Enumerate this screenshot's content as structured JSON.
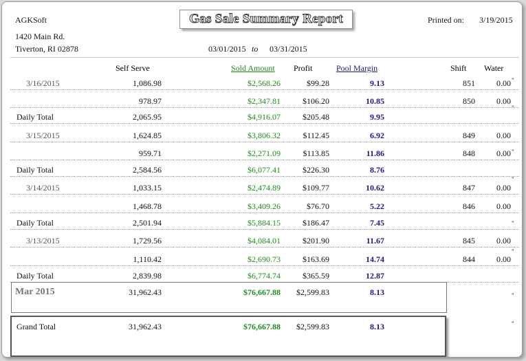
{
  "header": {
    "company": "AGKSoft",
    "address1": "1420 Main Rd.",
    "address2": "Tiverton, RI 02878",
    "title": "Gas Sale Summary Report",
    "printed_label": "Printed on:",
    "printed_date": "3/19/2015",
    "date_from": "03/01/2015",
    "date_to_word": "to",
    "date_to": "03/31/2015"
  },
  "columns": {
    "self_serve": "Self Serve",
    "sold_amount": "Sold Amount",
    "profit": "Profit",
    "pool_margin": "Pool Margin",
    "shift": "Shift",
    "water": "Water"
  },
  "rows": [
    {
      "type": "shift",
      "date": "3/16/2015",
      "self_serve": "1,086.98",
      "sold": "$2,568.26",
      "profit": "$99.28",
      "margin": "9.13",
      "shift": "851",
      "water": "0.00",
      "quote": "\""
    },
    {
      "type": "shift",
      "date": "",
      "self_serve": "978.97",
      "sold": "$2,347.81",
      "profit": "$106.20",
      "margin": "10.85",
      "shift": "850",
      "water": "0.00",
      "quote": "\""
    },
    {
      "type": "daily",
      "label": "Daily Total",
      "self_serve": "2,065.95",
      "sold": "$4,916.07",
      "profit": "$205.48",
      "margin": "9.95"
    },
    {
      "type": "shift",
      "date": "3/15/2015",
      "self_serve": "1,624.85",
      "sold": "$3,806.32",
      "profit": "$112.45",
      "margin": "6.92",
      "shift": "849",
      "water": "0.00",
      "quote": "\""
    },
    {
      "type": "shift",
      "date": "",
      "self_serve": "959.71",
      "sold": "$2,271.09",
      "profit": "$113.85",
      "margin": "11.86",
      "shift": "848",
      "water": "0.00",
      "quote": "\""
    },
    {
      "type": "daily",
      "label": "Daily Total",
      "self_serve": "2,584.56",
      "sold": "$6,077.41",
      "profit": "$226.30",
      "margin": "8.76"
    },
    {
      "type": "shift",
      "date": "3/14/2015",
      "self_serve": "1,033.15",
      "sold": "$2,474.89",
      "profit": "$109.77",
      "margin": "10.62",
      "shift": "847",
      "water": "0.00",
      "quote": "\""
    },
    {
      "type": "shift",
      "date": "",
      "self_serve": "1,468.78",
      "sold": "$3,409.26",
      "profit": "$76.70",
      "margin": "5.22",
      "shift": "846",
      "water": "0.00",
      "quote": "\""
    },
    {
      "type": "daily",
      "label": "Daily Total",
      "self_serve": "2,501.94",
      "sold": "$5,884.15",
      "profit": "$186.47",
      "margin": "7.45"
    },
    {
      "type": "shift",
      "date": "3/13/2015",
      "self_serve": "1,729.56",
      "sold": "$4,084.01",
      "profit": "$201.90",
      "margin": "11.67",
      "shift": "845",
      "water": "0.00",
      "quote": "\""
    },
    {
      "type": "shift",
      "date": "",
      "self_serve": "1,110.42",
      "sold": "$2,690.73",
      "profit": "$163.69",
      "margin": "14.74",
      "shift": "844",
      "water": "0.00",
      "quote": "\""
    },
    {
      "type": "daily",
      "label": "Daily Total",
      "self_serve": "2,839.98",
      "sold": "$6,774.74",
      "profit": "$365.59",
      "margin": "12.87"
    }
  ],
  "month": {
    "label": "Mar 2015",
    "self_serve": "31,962.43",
    "sold": "$76,667.88",
    "profit": "$2,599.83",
    "margin": "8.13"
  },
  "grand_total": {
    "label": "Grand Total",
    "self_serve": "31,962.43",
    "sold": "$76,667.88",
    "profit": "$2,599.83",
    "margin": "8.13"
  }
}
